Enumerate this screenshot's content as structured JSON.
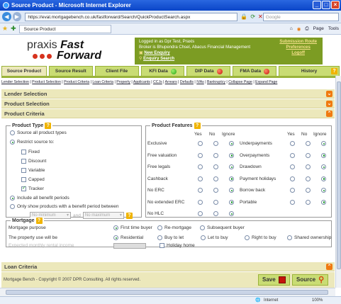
{
  "window": {
    "title": "Source Product - Microsoft Internet Explorer",
    "min": "_",
    "max": "□",
    "close": "×"
  },
  "browser": {
    "url": "https://eval.mortgagebench.co.uk/fastforward/Search/QuickProductSearch.aspx",
    "search_placeholder": "Google",
    "tab": "Source Product",
    "page_menu": "Page",
    "tools_menu": "Tools"
  },
  "header": {
    "logo_line1": "praxis",
    "logo_line1b": "Fast",
    "logo_line2": "Forward",
    "logged_in": "Logged in as Dpr Test, Praxis",
    "broker": "Broker is Bhupendra Chsel, Abacus Financial Management",
    "new_enquiry": "New Enquiry",
    "enquiry_search": "Enquiry Search",
    "submission_route": "Submission Route",
    "preferences": "Preferences",
    "logoff": "Logoff"
  },
  "tabs": [
    {
      "label": "Source Product"
    },
    {
      "label": "Source Result"
    },
    {
      "label": "Client File"
    },
    {
      "label": "KFI Data"
    },
    {
      "label": "DIP Data"
    },
    {
      "label": "FMA Data"
    },
    {
      "label": "History"
    }
  ],
  "help": "?",
  "sublinks": [
    "Lender Selection",
    "Product Selection",
    "Product Criteria",
    "Loan Criteria",
    "Property",
    "Applicants",
    "CCJs",
    "Arrears",
    "Defaults",
    "IVAs",
    "Bankruptcy",
    "Collapse Page",
    "Expand Page"
  ],
  "sections": {
    "lender": "Lender Selection",
    "product": "Product Selection",
    "criteria": "Product Criteria",
    "loan": "Loan Criteria"
  },
  "product_type": {
    "legend": "Product Type",
    "all": "Source all product types",
    "restrict": "Restrict source to:",
    "types": [
      "Fixed",
      "Discount",
      "Variable",
      "Capped",
      "Tracker"
    ],
    "include_all": "Include all benefit periods",
    "only_show": "Only show products with a benefit period between",
    "min": "No minimum",
    "and": "and",
    "max": "No maximum"
  },
  "features": {
    "legend": "Product Features",
    "yes": "Yes",
    "no": "No",
    "ignore": "Ignore",
    "left": [
      "Exclusive",
      "Free valuation",
      "Free legals",
      "Cashback",
      "No ERC",
      "No extended ERC",
      "No HLC"
    ],
    "right": [
      "Underpayments",
      "Overpayments",
      "Drawdown",
      "Payment holidays",
      "Borrow back",
      "Portable"
    ]
  },
  "mortgage": {
    "legend": "Mortgage",
    "purpose_label": "Mortgage purpose",
    "purposes": [
      "First time buyer",
      "Re-mortgage",
      "Subsequent buyer"
    ],
    "use_label": "The property use will be",
    "uses": [
      "Residential",
      "Buy to let",
      "Let to buy",
      "Right to buy",
      "Shared ownership"
    ],
    "rental_label": "Expected monthly rental income",
    "holiday": "Holiday home"
  },
  "footer": {
    "copyright": "Mortgage Bench - Copyright © 2007 DPR Consulting. All rights reserved.",
    "save": "Save",
    "source": "Source"
  },
  "status": {
    "zone": "Internet",
    "zoom": "100%"
  },
  "icons": {
    "back": "back-arrow-icon",
    "forward": "forward-arrow-icon",
    "lock": "lock-icon",
    "save": "floppy-disk-icon",
    "source": "magnifier-icon"
  }
}
